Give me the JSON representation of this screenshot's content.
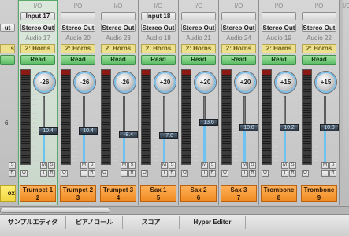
{
  "left_partial": {
    "output": "ut",
    "group_suffix": "s",
    "meter_values": [
      "6",
      "S",
      "R"
    ],
    "name_fragment": "ox"
  },
  "right_partial": {
    "io": "I/O"
  },
  "strips": [
    {
      "io": "I/O",
      "input": "Input 17",
      "output": "Stereo Out",
      "audio": "Audio 17",
      "group": "2: Horns",
      "rec": "Read",
      "pan": "-26",
      "fader": "10.4",
      "name": "Trumpet 1",
      "number": "2",
      "selected": true,
      "level": 0.46
    },
    {
      "io": "I/O",
      "input": "",
      "output": "Stereo Out",
      "audio": "Audio 20",
      "group": "2: Horns",
      "rec": "Read",
      "pan": "-26",
      "fader": "10.4",
      "name": "Trumpet 2",
      "number": "3",
      "selected": false,
      "level": 0.46
    },
    {
      "io": "I/O",
      "input": "",
      "output": "Stereo Out",
      "audio": "Audio 23",
      "group": "2: Horns",
      "rec": "Read",
      "pan": "-26",
      "fader": "-8.4",
      "name": "Trumpet 3",
      "number": "4",
      "selected": false,
      "level": 0.52
    },
    {
      "io": "I/O",
      "input": "Input 18",
      "output": "Stereo Out",
      "audio": "Audio 18",
      "group": "2: Horns",
      "rec": "Read",
      "pan": "+20",
      "fader": "-7.8",
      "name": "Sax 1",
      "number": "5",
      "selected": false,
      "level": 0.53
    },
    {
      "io": "I/O",
      "input": "",
      "output": "Stereo Out",
      "audio": "Audio 21",
      "group": "2: Horns",
      "rec": "Read",
      "pan": "+20",
      "fader": "13.6",
      "name": "Sax 2",
      "number": "6",
      "selected": false,
      "level": 0.34
    },
    {
      "io": "I/O",
      "input": "",
      "output": "Stereo Out",
      "audio": "Audio 24",
      "group": "2: Horns",
      "rec": "Read",
      "pan": "+20",
      "fader": "10.8",
      "name": "Sax 3",
      "number": "7",
      "selected": false,
      "level": 0.42
    },
    {
      "io": "I/O",
      "input": "",
      "output": "Stereo Out",
      "audio": "Audio 19",
      "group": "2: Horns",
      "rec": "Read",
      "pan": "+15",
      "fader": "10.2",
      "name": "Trombone",
      "number": "8",
      "selected": false,
      "level": 0.42
    },
    {
      "io": "I/O",
      "input": "",
      "output": "Stereo Out",
      "audio": "Audio 22",
      "group": "2: Horns",
      "rec": "Read",
      "pan": "+15",
      "fader": "10.8",
      "name": "Trombone",
      "number": "9",
      "selected": false,
      "level": 0.42
    }
  ],
  "buttons": {
    "mute": "M",
    "solo": "S",
    "out": "O",
    "input_mon": "I",
    "rec_enable": "R"
  },
  "tabs": [
    "サンプルエディタ",
    "ピアノロール",
    "スコア",
    "Hyper Editor"
  ]
}
